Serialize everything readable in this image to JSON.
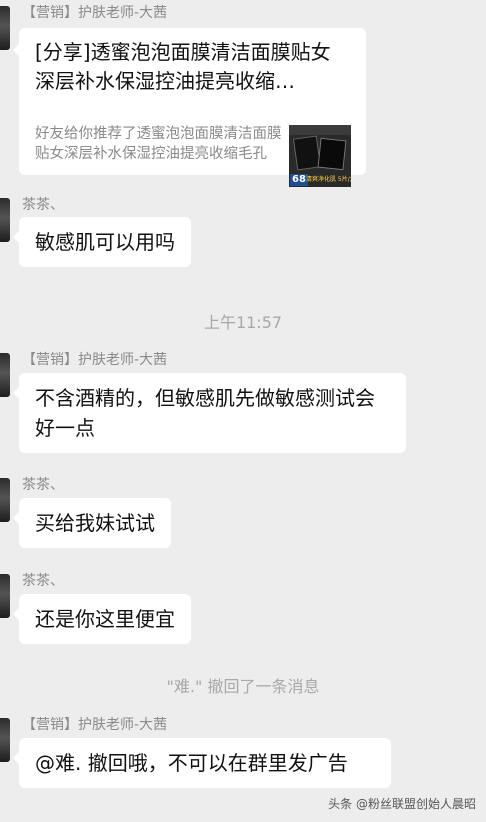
{
  "messages": {
    "m1": {
      "sender": "【营销】护肤老师-大茜",
      "card_title": "[分享]透蜜泡泡面膜清洁面膜贴女深层补水保湿控油提亮收缩…",
      "card_desc": "好友给你推荐了透蜜泡泡面膜清洁面膜贴女深层补水保湿控油提亮收缩毛孔",
      "thumb_price": "68",
      "thumb_tag": "清爽净化肌 5片/盒"
    },
    "m2": {
      "sender": "茶茶、",
      "text": "敏感肌可以用吗"
    },
    "time1": "上午11:57",
    "m3": {
      "sender": "【营销】护肤老师-大茜",
      "text": "不含酒精的，但敏感肌先做敏感测试会好一点"
    },
    "m4": {
      "sender": "茶茶、",
      "text": "买给我妹试试"
    },
    "m5": {
      "sender": "茶茶、",
      "text": "还是你这里便宜"
    },
    "system1": "\"难.\" 撤回了一条消息",
    "m6": {
      "sender": "【营销】护肤老师-大茜",
      "text": "@难. 撤回哦，不可以在群里发广告"
    }
  },
  "watermark": "头条 @粉丝联盟创始人晨昭"
}
